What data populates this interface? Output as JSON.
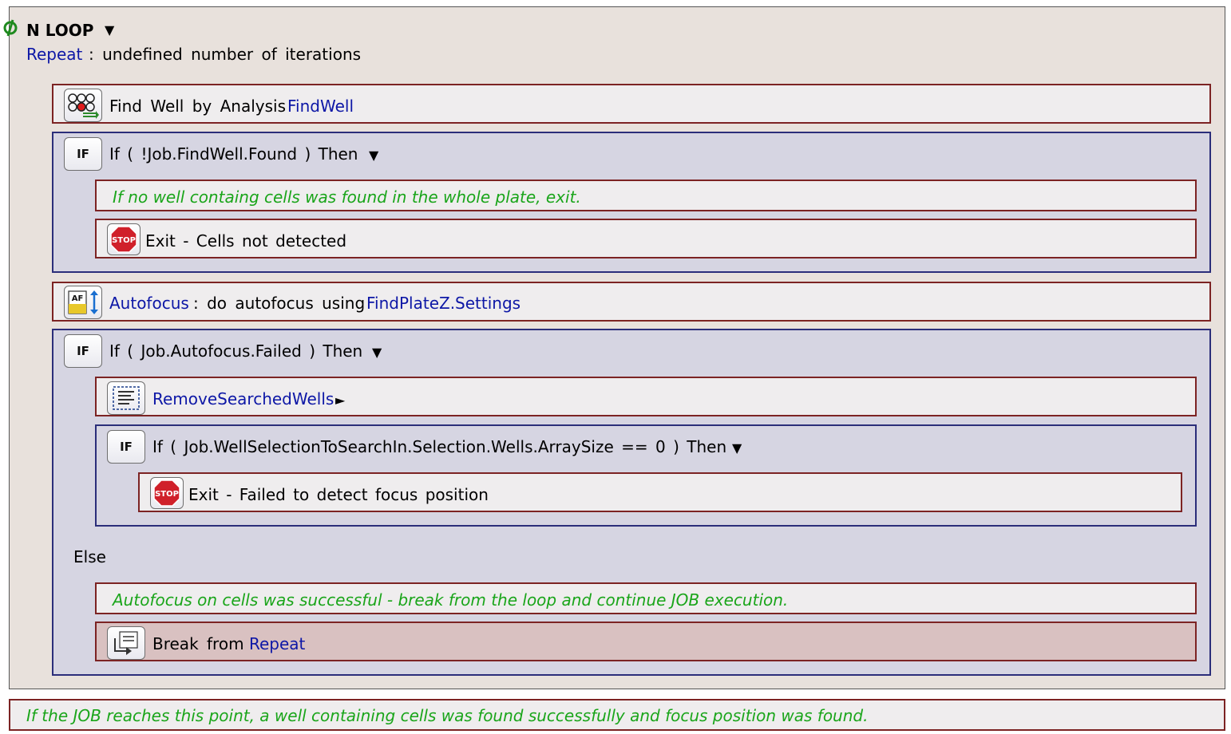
{
  "loop": {
    "title": "N LOOP",
    "dropdown_glyph": "▼",
    "repeat_keyword": "Repeat",
    "repeat_desc": ": undefined number of iterations"
  },
  "find_well": {
    "text": "Find Well by Analysis",
    "link": "FindWell",
    "icon": "well-analysis-icon"
  },
  "if1": {
    "keyword": "IF",
    "text": "If ( !Job.FindWell.Found ) Then",
    "dropdown_glyph": "▼",
    "comment": "If no well containg cells was found in the whole plate, exit.",
    "exit_text": "Exit - Cells not detected",
    "stop_label": "STOP"
  },
  "autofocus": {
    "link": "Autofocus",
    "text": ": do autofocus using",
    "settings_link": "FindPlateZ.Settings",
    "icon_label": "AF"
  },
  "if2": {
    "keyword": "IF",
    "text": "If ( Job.Autofocus.Failed ) Then",
    "dropdown_glyph": "▼",
    "remove_link": "RemoveSearchedWells",
    "expand_glyph": "►",
    "inner_if": {
      "keyword": "IF",
      "text": "If ( Job.WellSelectionToSearchIn.Selection.Wells.ArraySize == 0 ) Then",
      "dropdown_glyph": "▼",
      "exit_text": "Exit - Failed to detect focus position",
      "stop_label": "STOP"
    },
    "else_label": "Else",
    "else_comment": "Autofocus on cells was successful - break from the loop and continue JOB execution.",
    "break_text": "Break from",
    "break_link": "Repeat"
  },
  "footer_comment": "If the JOB reaches this point, a well containing cells was found successfully and focus position was found.",
  "colors": {
    "link_blue": "#0d17a6",
    "comment_green": "#1aa51a",
    "loop_bg": "#e8e1dc",
    "if_bg": "#d6d5e2",
    "step_border": "#7c2323",
    "if_border": "#2b2e7a",
    "stop_red": "#d0202a"
  }
}
